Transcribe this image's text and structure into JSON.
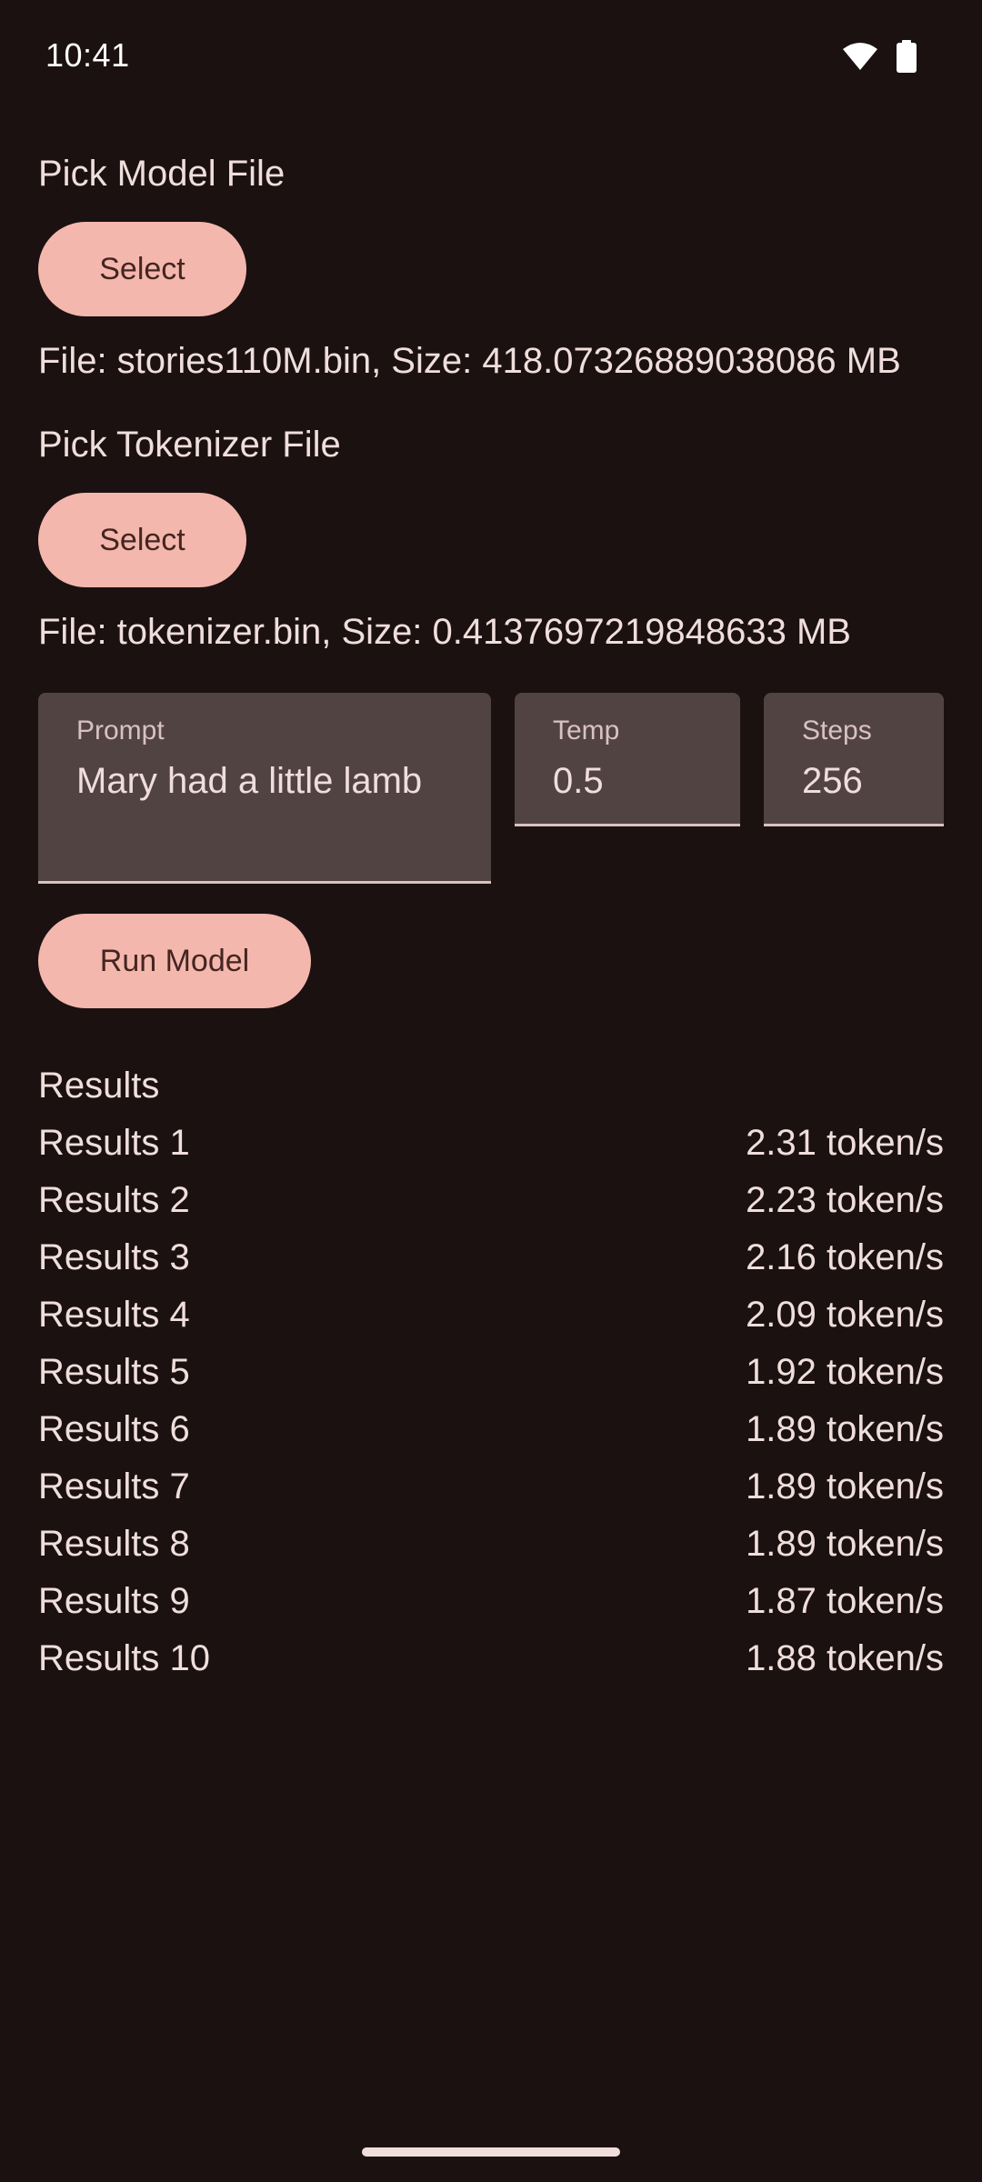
{
  "status_bar": {
    "time": "10:41",
    "icons": [
      "wifi-icon",
      "battery-icon"
    ]
  },
  "model_section": {
    "title": "Pick Model File",
    "button_label": "Select",
    "file_info": "File: stories110M.bin, Size: 418.07326889038086 MB"
  },
  "tokenizer_section": {
    "title": "Pick Tokenizer File",
    "button_label": "Select",
    "file_info": "File: tokenizer.bin, Size: 0.4137697219848633 MB"
  },
  "inputs": {
    "prompt": {
      "label": "Prompt",
      "value": "Mary had a little lamb"
    },
    "temp": {
      "label": "Temp",
      "value": "0.5"
    },
    "steps": {
      "label": "Steps",
      "value": "256"
    }
  },
  "run_button_label": "Run Model",
  "results": {
    "title": "Results",
    "rows": [
      {
        "label": "Results 1",
        "value": "2.31 token/s"
      },
      {
        "label": "Results 2",
        "value": "2.23 token/s"
      },
      {
        "label": "Results 3",
        "value": "2.16 token/s"
      },
      {
        "label": "Results 4",
        "value": "2.09 token/s"
      },
      {
        "label": "Results 5",
        "value": "1.92 token/s"
      },
      {
        "label": "Results 6",
        "value": "1.89 token/s"
      },
      {
        "label": "Results 7",
        "value": "1.89 token/s"
      },
      {
        "label": "Results 8",
        "value": "1.89 token/s"
      },
      {
        "label": "Results 9",
        "value": "1.87 token/s"
      },
      {
        "label": "Results 10",
        "value": "1.88 token/s"
      }
    ]
  },
  "colors": {
    "background": "#1b1111",
    "button": "#f4b7ad",
    "button_text": "#442521",
    "field_bg": "#514341",
    "text": "#f0dedc"
  }
}
